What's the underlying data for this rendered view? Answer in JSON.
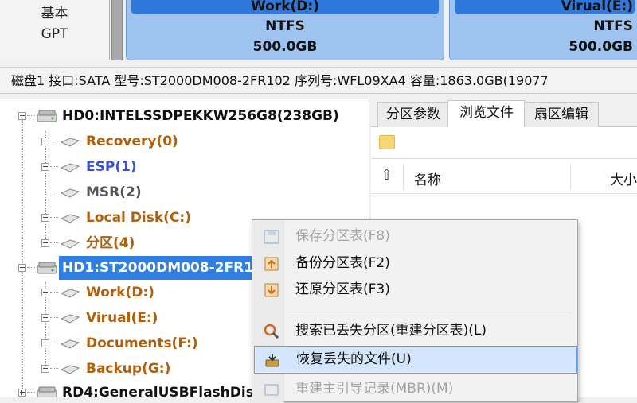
{
  "diskmap": {
    "disk_type_line1": "基本",
    "disk_type_line2": "GPT",
    "partitions": [
      {
        "name": "Work(D:)",
        "fs": "NTFS",
        "size": "500.0GB"
      },
      {
        "name": "Virual(E:)",
        "fs": "NTFS",
        "size": "500.0GB"
      }
    ]
  },
  "infobar": {
    "text": "磁盘1 接口:SATA  型号:ST2000DM008-2FR102  序列号:WFL09XA4  容量:1863.0GB(19077"
  },
  "tree": {
    "items": [
      {
        "label": "HD0:INTELSSDPEKKW256G8(238GB)",
        "type": "disk"
      },
      {
        "label": "Recovery(0)",
        "type": "partition"
      },
      {
        "label": "ESP(1)",
        "type": "partition"
      },
      {
        "label": "MSR(2)",
        "type": "partition"
      },
      {
        "label": "Local Disk(C:)",
        "type": "partition"
      },
      {
        "label": "分区(4)",
        "type": "partition"
      },
      {
        "label": "HD1:ST2000DM008-2FR10",
        "type": "disk",
        "selected": true
      },
      {
        "label": "Work(D:)",
        "type": "partition"
      },
      {
        "label": "Virual(E:)",
        "type": "partition"
      },
      {
        "label": "Documents(F:)",
        "type": "partition"
      },
      {
        "label": "Backup(G:)",
        "type": "partition"
      },
      {
        "label": "RD4:GeneralUSBFlashDis",
        "type": "disk"
      }
    ]
  },
  "right_panel": {
    "tabs": [
      {
        "label": "分区参数",
        "active": false
      },
      {
        "label": "浏览文件",
        "active": true
      },
      {
        "label": "扇区编辑",
        "active": false
      }
    ],
    "columns": {
      "name": "名称",
      "size": "大小"
    }
  },
  "context_menu": {
    "items": [
      {
        "label": "保存分区表(F8)",
        "icon": "save-icon",
        "disabled": true
      },
      {
        "label": "备份分区表(F2)",
        "icon": "backup-icon",
        "disabled": false
      },
      {
        "label": "还原分区表(F3)",
        "icon": "restore-icon",
        "disabled": false
      },
      {
        "label": "搜索已丢失分区(重建分区表)(L)",
        "icon": "search-icon",
        "disabled": false
      },
      {
        "label": "恢复丢失的文件(U)",
        "icon": "recover-files-icon",
        "disabled": false,
        "highlighted": true
      },
      {
        "label": "重建主引导记录(MBR)(M)",
        "icon": "rebuild-mbr-icon",
        "disabled": true
      }
    ]
  },
  "colors": {
    "selection": "#2f7ee0",
    "partition_label": "#b35f0a",
    "esp_label": "#3c4fd9",
    "menu_highlight": "#d3e6fb"
  }
}
